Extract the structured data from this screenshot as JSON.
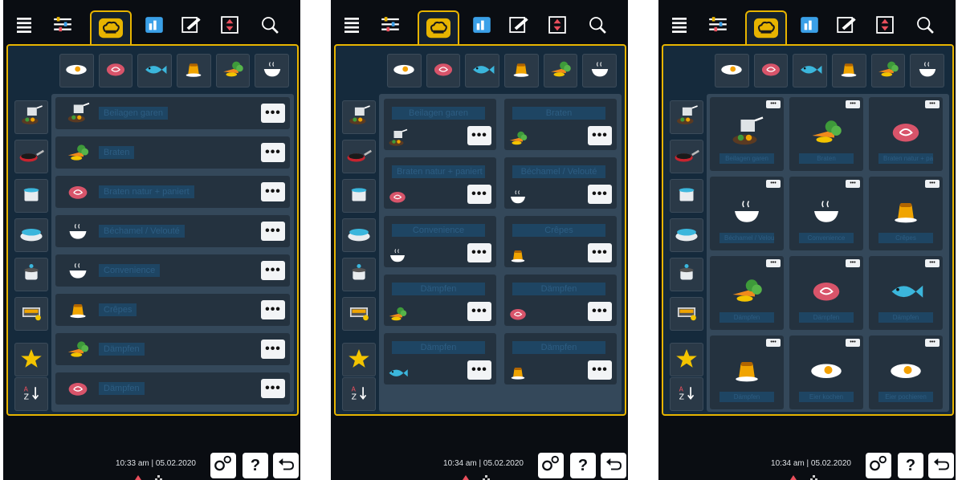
{
  "colors": {
    "accent": "#e7b400",
    "panel": "#152a3c",
    "label_text": "#2d5d82"
  },
  "icons": {
    "topbar": [
      "menu-icon",
      "filter-icon",
      "chef-hat-icon",
      "cook-icon",
      "edit-icon",
      "height-icon",
      "search-icon"
    ],
    "categories": [
      "egg-icon",
      "meat-icon",
      "fish-icon",
      "dessert-icon",
      "vegetable-icon",
      "soup-icon"
    ],
    "side": [
      "pan-steam-icon",
      "frying-pan-icon",
      "pot-icon",
      "lid-pan-icon",
      "boil-pot-icon",
      "tray-icon",
      "star-icon",
      "sort-az-icon"
    ],
    "bottom": [
      "settings-icon",
      "help-icon",
      "back-icon"
    ]
  },
  "screen1": {
    "time": "10:33 am | 05.02.2020",
    "rows": [
      {
        "label": "Beilagen garen",
        "icon": "pan-steam-icon"
      },
      {
        "label": "Braten",
        "icon": "vegetable-icon"
      },
      {
        "label": "Braten natur + paniert",
        "icon": "meat-icon"
      },
      {
        "label": "Béchamel / Velouté",
        "icon": "soup-icon"
      },
      {
        "label": "Convenience",
        "icon": "soup-icon"
      },
      {
        "label": "Crêpes",
        "icon": "dessert-icon"
      },
      {
        "label": "Dämpfen",
        "icon": "vegetable-icon"
      },
      {
        "label": "Dämpfen",
        "icon": "meat-icon"
      }
    ],
    "more_label": "•••"
  },
  "screen2": {
    "time": "10:34 am | 05.02.2020",
    "cards": [
      {
        "label": "Beilagen garen",
        "icon": "pan-steam-icon"
      },
      {
        "label": "Braten",
        "icon": "vegetable-icon"
      },
      {
        "label": "Braten natur + paniert",
        "icon": "meat-icon"
      },
      {
        "label": "Béchamel / Velouté",
        "icon": "soup-icon"
      },
      {
        "label": "Convenience",
        "icon": "soup-icon"
      },
      {
        "label": "Crêpes",
        "icon": "dessert-icon"
      },
      {
        "label": "Dämpfen",
        "icon": "vegetable-icon"
      },
      {
        "label": "Dämpfen",
        "icon": "meat-icon"
      },
      {
        "label": "Dämpfen",
        "icon": "fish-icon"
      },
      {
        "label": "Dämpfen",
        "icon": "dessert-icon"
      }
    ],
    "more_label": "•••"
  },
  "screen3": {
    "time": "10:34 am | 05.02.2020",
    "cards": [
      {
        "label": "Beilagen garen",
        "icon": "pan-steam-icon"
      },
      {
        "label": "Braten",
        "icon": "vegetable-icon"
      },
      {
        "label": "Braten natur + paniert",
        "icon": "meat-icon"
      },
      {
        "label": "Béchamel / Velouté",
        "icon": "soup-icon"
      },
      {
        "label": "Convenience",
        "icon": "soup-icon"
      },
      {
        "label": "Crêpes",
        "icon": "dessert-icon"
      },
      {
        "label": "Dämpfen",
        "icon": "vegetable-icon"
      },
      {
        "label": "Dämpfen",
        "icon": "meat-icon"
      },
      {
        "label": "Dämpfen",
        "icon": "fish-icon"
      },
      {
        "label": "Dämpfen",
        "icon": "dessert-icon"
      },
      {
        "label": "Eier kochen",
        "icon": "egg-icon"
      },
      {
        "label": "Eier pochieren",
        "icon": "egg-icon"
      }
    ],
    "more_label": "•••"
  },
  "bottom": {
    "help_label": "?"
  }
}
